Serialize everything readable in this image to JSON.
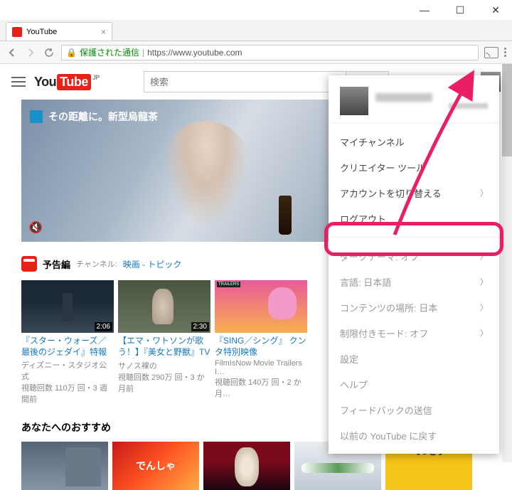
{
  "window": {
    "tab_title": "YouTube",
    "url_secure": "保護された通信",
    "url": "https://www.youtube.com"
  },
  "header": {
    "logo_you": "You",
    "logo_tube": "Tube",
    "region": "JP",
    "search_placeholder": "検索"
  },
  "hero": {
    "ad_text": "その距離に。新型烏龍茶"
  },
  "section": {
    "title": "予告編",
    "sub_label": "チャンネル:",
    "link": "映画 - トピック"
  },
  "videos": [
    {
      "title": "『スター・ウォーズ／最後のジェダイ』特報",
      "by": "ディズニー・スタジオ公式",
      "meta": "視聴回数 110万 回・3 週間前",
      "dur": "2:06"
    },
    {
      "title": "【エマ・ワトソンが歌う！】『美女と野獣』TVスポット…",
      "by": "サノス裸の",
      "meta": "視聴回数 290万 回・3 か月前",
      "dur": "2:30"
    },
    {
      "title": "『SING／シング』 クンタ特別映像",
      "by": "FilmIsNow Movie Trailers I…",
      "meta": "視聴回数 140万 回・2 か月…",
      "dur": ""
    }
  ],
  "rec": {
    "title": "あなたへのおすすめ",
    "r2_text": "でんしゃ",
    "r5_text": "てつどう"
  },
  "menu": {
    "items1": [
      "マイチャンネル",
      "クリエイター ツール"
    ],
    "switch": "アカウントを切り替える",
    "logout": "ログアウト",
    "dark": "ダークテーマ: オフ",
    "lang": "言語: 日本語",
    "loc": "コンテンツの場所: 日本",
    "restricted": "制限付きモード: オフ",
    "items3": [
      "設定",
      "ヘルプ",
      "フィードバックの送信",
      "以前の YouTube に戻す"
    ]
  }
}
